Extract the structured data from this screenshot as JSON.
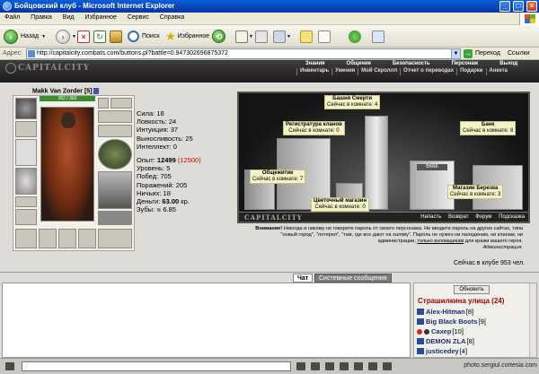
{
  "window": {
    "title": "Бойцовский клуб - Microsoft Internet Explorer"
  },
  "menu": [
    "Файл",
    "Правка",
    "Вид",
    "Избранное",
    "Сервис",
    "Справка"
  ],
  "toolbar": {
    "back": "Назад",
    "search": "Поиск",
    "favorites": "Избранное"
  },
  "address": {
    "label": "Адрес:",
    "url": "http://capitalcity.combats.com/buttons.pl?battle=0.947302696875372",
    "go": "Переход",
    "links": "Ссылки"
  },
  "site": {
    "logo": "CAPITALCITY",
    "nav_top": [
      "Знания",
      "Общение",
      "Безопасность",
      "Персонаж",
      "Выход"
    ],
    "nav_sub": [
      "Инвентарь",
      "Умения",
      "Мой Скроллл",
      "Отчет о переводах",
      "Подарки",
      "Анкета"
    ]
  },
  "character": {
    "name": "Makk Van Zorder",
    "level": "[5]",
    "hp": "362 / 362",
    "stats": [
      {
        "label": "Сила:",
        "value": "18"
      },
      {
        "label": "Ловкость:",
        "value": "24"
      },
      {
        "label": "Интуиция:",
        "value": "37"
      },
      {
        "label": "Выносливость:",
        "value": "25"
      },
      {
        "label": "Интеллект:",
        "value": "0"
      }
    ],
    "exp_label": "Опыт:",
    "exp_value": "12499",
    "exp_next": "(12500)",
    "info": [
      {
        "label": "Уровень:",
        "value": "5"
      },
      {
        "label": "Побед:",
        "value": "705"
      },
      {
        "label": "Поражений:",
        "value": "205"
      },
      {
        "label": "Ничьих:",
        "value": "18"
      }
    ],
    "money_label": "Деньги:",
    "money_value": "63.00",
    "money_unit": "кр.",
    "teeth_label": "Зубы:",
    "teeth_value": "6.85"
  },
  "map": {
    "tags": [
      {
        "title": "Башня Смерти",
        "sub": "Сейчас в комнате: 4"
      },
      {
        "title": "Регистратура кланов",
        "sub": "Сейчас в комнате: 0"
      },
      {
        "title": "Банк",
        "sub": "Сейчас в комнате: 8"
      },
      {
        "title": "Общежитие",
        "sub": "Сейчас в комнате: 7"
      },
      {
        "title": "Цветочный магазин",
        "sub": "Сейчас в комнате: 0"
      },
      {
        "title": "Магазин Березка",
        "sub": "Сейчас в комнате: 3"
      }
    ],
    "bank_sign": "BANK",
    "footer_logo": "CAPITALCITY",
    "footer_links": [
      "Напасть",
      "Возврат",
      "Форум",
      "Подсказка"
    ]
  },
  "warning": {
    "lead": "Внимание!",
    "text": "Никогда и никому не говорите пароль от своего персонажа. Не вводите пароль на других сайтах, типа \"новый город\", \"лотерея\", \"там, где все дают на халяву\". Пароль не нужен ни паладинам, ни кланам, ни администрации,",
    "link": "только взломщикам",
    "tail": "для кражи вашего героя.",
    "sign": "Администрация.",
    "online": "Сейчас в клубе 953 чел."
  },
  "chat": {
    "tab_chat": "Чат",
    "tab_system": "Системные сообщения",
    "refresh": "Обновить",
    "room": "Страшилкина улица (24)",
    "users": [
      {
        "name": "Alex-Hitman",
        "meta": "[8]"
      },
      {
        "name": "Big Black Boots",
        "meta": "[9]"
      },
      {
        "name": "Сахер",
        "meta": "[10]"
      },
      {
        "name": "DEMON ZLA",
        "meta": "[8]"
      },
      {
        "name": "justicedey",
        "meta": "[4]"
      }
    ]
  },
  "watermark": "photo.sergiul.cortesia.com"
}
